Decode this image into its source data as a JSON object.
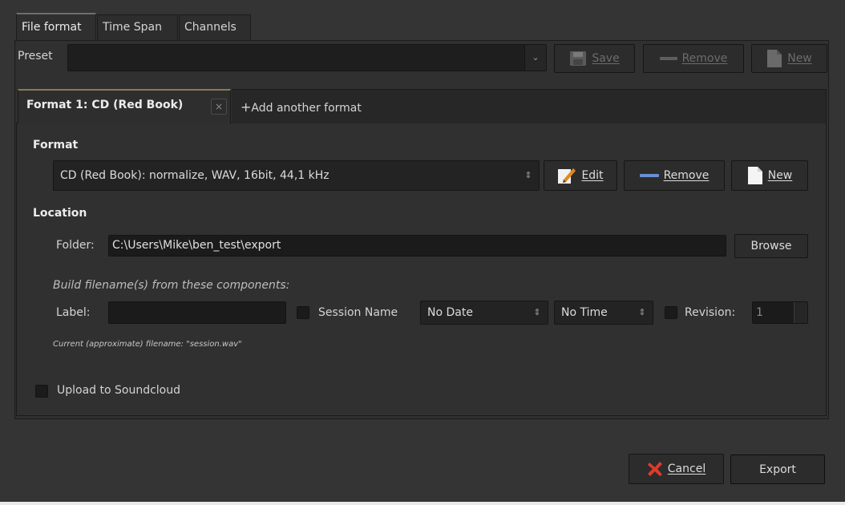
{
  "tabs": [
    {
      "label": "File format",
      "active": true
    },
    {
      "label": "Time Span",
      "active": false
    },
    {
      "label": "Channels",
      "active": false
    }
  ],
  "preset": {
    "label": "Preset",
    "value": "",
    "save_label": "Save",
    "remove_label": "Remove",
    "new_label": "New"
  },
  "format_tabs": {
    "active_label": "Format 1: CD (Red Book)",
    "close_glyph": "×",
    "add_label": "Add another format",
    "add_glyph": "+"
  },
  "format": {
    "heading": "Format",
    "value": "CD (Red Book): normalize, WAV, 16bit, 44,1 kHz",
    "edit_label": "Edit",
    "remove_label": "Remove",
    "new_label": "New"
  },
  "location": {
    "heading": "Location",
    "folder_label": "Folder:",
    "folder_value": "C:\\Users\\Mike\\ben_test\\export",
    "browse_label": "Browse"
  },
  "filename": {
    "build_hint": "Build filename(s) from these components:",
    "label_label": "Label:",
    "label_value": "",
    "session_name_label": "Session Name",
    "session_name_checked": false,
    "date_value": "No Date",
    "time_value": "No Time",
    "revision_label": "Revision:",
    "revision_checked": false,
    "revision_value": "1",
    "current_filename": "Current (approximate) filename: \"session.wav\""
  },
  "upload": {
    "label": "Upload to Soundcloud",
    "checked": false
  },
  "footer": {
    "cancel_label": "Cancel",
    "export_label": "Export"
  },
  "icons": {
    "save": "floppy-disk-icon",
    "remove": "minus-bar-icon",
    "new": "blank-page-icon",
    "edit": "pencil-note-icon",
    "cancel": "red-x-icon"
  },
  "colors": {
    "window_bg": "#343434",
    "entry_bg": "#1b1b1b",
    "accent_tab": "#8a7a56",
    "remove_blue": "#6a8fd0",
    "cancel_red": "#e03a2a"
  }
}
